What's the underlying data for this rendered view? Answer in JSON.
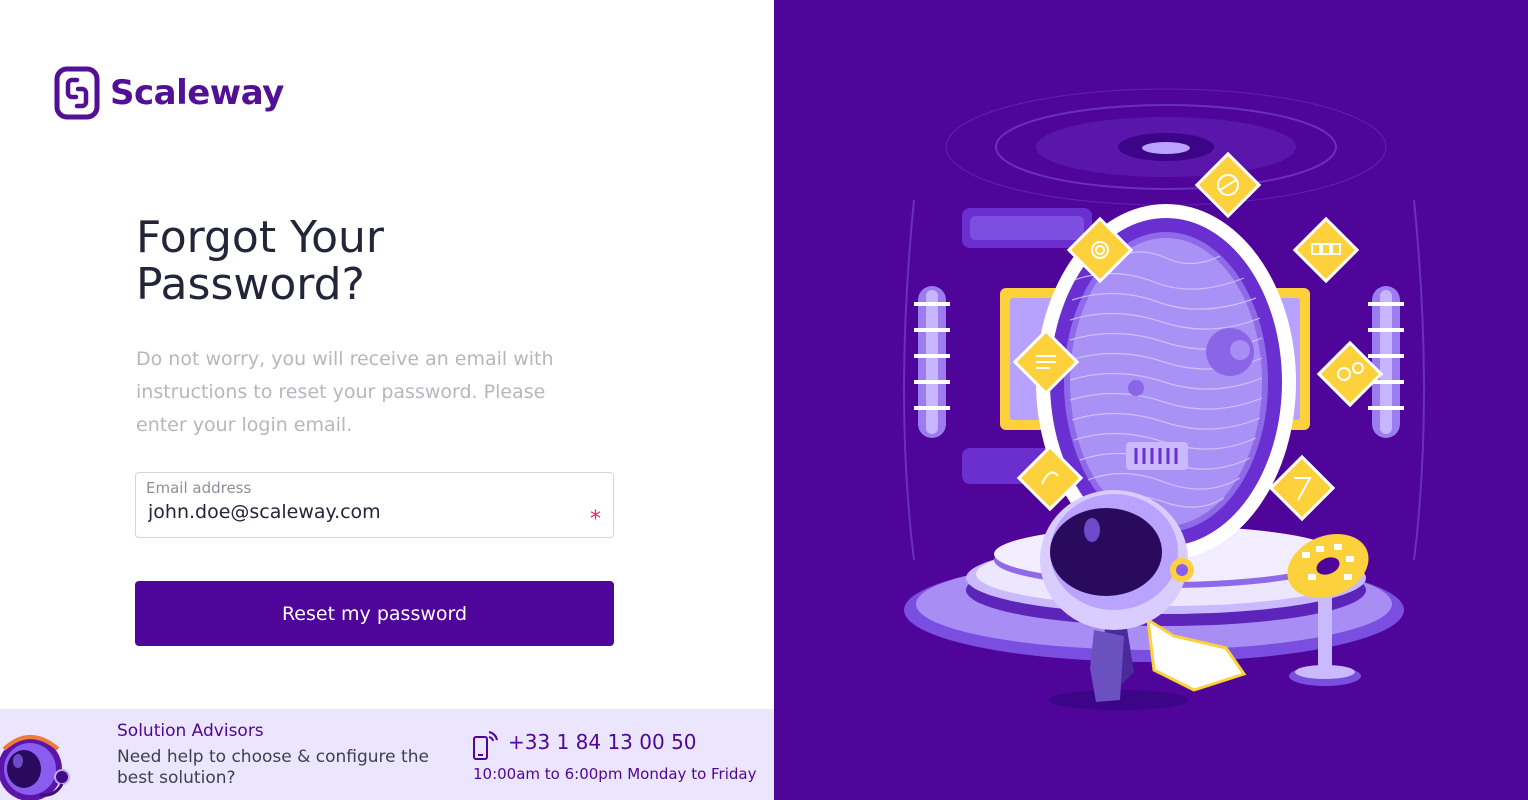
{
  "brand": {
    "name": "Scaleway"
  },
  "form": {
    "title": "Forgot Your Password?",
    "description": "Do not worry, you will receive an email with instructions to reset your password. Please enter your login email.",
    "email_label": "Email address",
    "email_value": "john.doe@scaleway.com",
    "required_mark": "*",
    "submit_label": "Reset my password"
  },
  "advisor": {
    "title": "Solution Advisors",
    "text": "Need help to choose & configure the best solution?",
    "phone": "+33 1 84 13 00 50",
    "hours": "10:00am to 6:00pm Monday to Friday"
  },
  "colors": {
    "brand_purple": "#4f0599",
    "accent_yellow": "#fcd13c",
    "required_pink": "#e5266d",
    "advisor_bg": "#ebe6fd"
  },
  "icons": {
    "logo": "scaleway-logo-icon",
    "phone": "mobile-phone-icon",
    "avatar": "astronaut-advisor-icon"
  }
}
